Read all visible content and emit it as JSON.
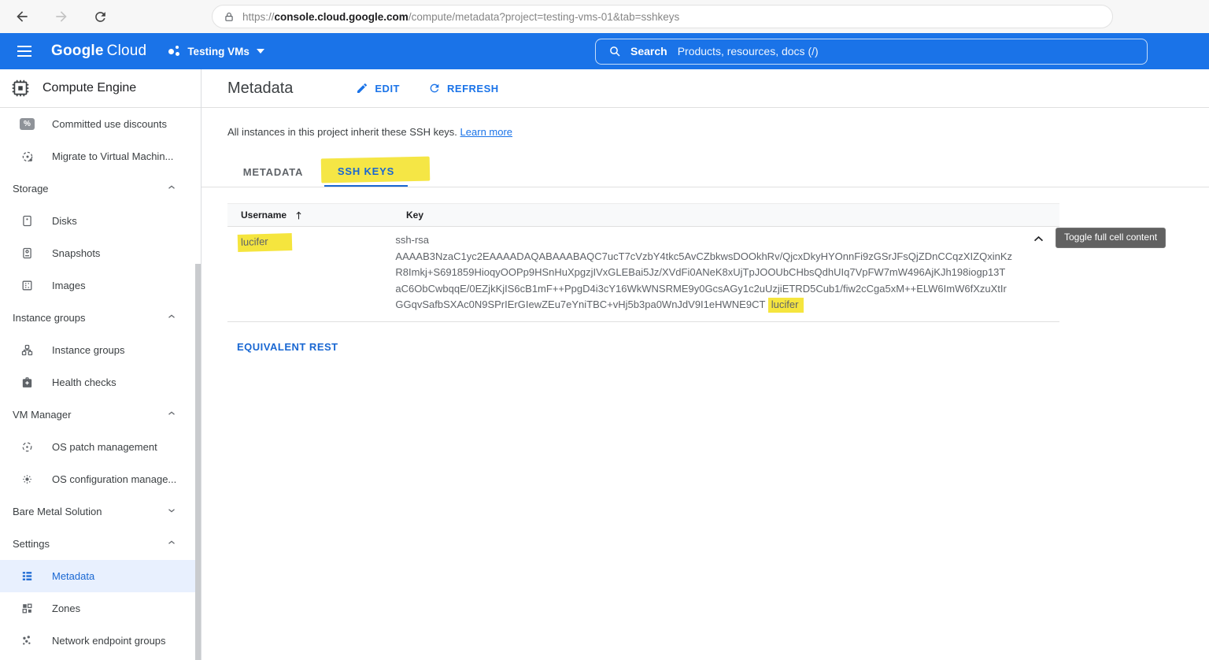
{
  "browser": {
    "url_scheme": "https://",
    "url_host": "console.cloud.google.com",
    "url_path": "/compute/metadata?project=testing-vms-01&tab=sshkeys"
  },
  "header": {
    "logo_google": "Google",
    "logo_cloud": "Cloud",
    "project_name": "Testing VMs",
    "search_label": "Search",
    "search_hint": "Products, resources, docs (/)"
  },
  "sidebar": {
    "product": "Compute Engine",
    "items": [
      {
        "label": "Committed use discounts"
      },
      {
        "label": "Migrate to Virtual Machin..."
      },
      {
        "label": "Storage"
      },
      {
        "label": "Disks"
      },
      {
        "label": "Snapshots"
      },
      {
        "label": "Images"
      },
      {
        "label": "Instance groups"
      },
      {
        "label": "Instance groups"
      },
      {
        "label": "Health checks"
      },
      {
        "label": "VM Manager"
      },
      {
        "label": "OS patch management"
      },
      {
        "label": "OS configuration manage..."
      },
      {
        "label": "Bare Metal Solution"
      },
      {
        "label": "Settings"
      },
      {
        "label": "Metadata"
      },
      {
        "label": "Zones"
      },
      {
        "label": "Network endpoint groups"
      }
    ]
  },
  "main": {
    "title": "Metadata",
    "edit_label": "EDIT",
    "refresh_label": "REFRESH",
    "description": "All instances in this project inherit these SSH keys.",
    "learn_more": "Learn more",
    "tabs": [
      {
        "label": "METADATA"
      },
      {
        "label": "SSH KEYS"
      }
    ],
    "table": {
      "col_username": "Username",
      "col_key": "Key",
      "row": {
        "username": "lucifer",
        "key_lines": [
          "ssh-rsa",
          "AAAAB3NzaC1yc2EAAAADAQABAAABAQC7ucT7cVzbY4tkc5AvCZbkwsDOOkhRv/QjcxDkyHYOnnFi9zGSrJFsQjZDnCCqzXIZQxinKz",
          "R8Imkj+S691859HioqyOOPp9HSnHuXpgzjIVxGLEBai5Jz/XVdFi0ANeK8xUjTpJOOUbCHbsQdhUIq7VpFW7mW496AjKJh198iogp13T",
          "aC6ObCwbqqE/0EZjkKjIS6cB1mF++PpgD4i3cY16WkWNSRME9y0GcsAGy1c2uUzjiETRD5Cub1/fiw2cCga5xM++ELW6ImW6fXzuXtIr",
          "GGqvSafbSXAc0N9SPrIErGIewZEu7eYniTBC+vHj5b3pa0WnJdV9I1eHWNE9CT"
        ],
        "key_comment": "lucifer"
      }
    },
    "tooltip": "Toggle full cell content",
    "equivalent_rest": "EQUIVALENT REST"
  },
  "colors": {
    "accent_blue": "#1a73e8",
    "active_tab_blue": "#1967d2",
    "highlight_yellow": "#f3e11c",
    "selected_item_bg": "#e8f0fe",
    "tooltip_bg": "#616161"
  }
}
